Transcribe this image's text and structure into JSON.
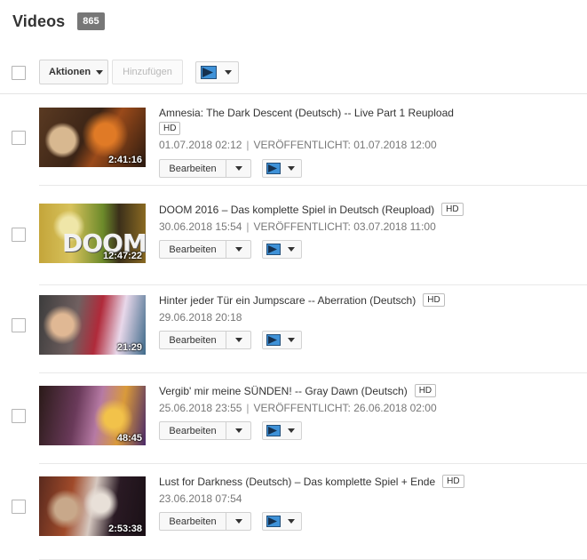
{
  "header": {
    "title": "Videos",
    "count": "865"
  },
  "toolbar": {
    "actions_label": "Aktionen",
    "add_label": "Hinzufügen"
  },
  "icons": {
    "dropdown": "chevron-down-icon",
    "playlist": "playlist-add-icon"
  },
  "colors": {
    "badge_bg": "#777777",
    "playlist_icon": "#3f92d8",
    "meta_text": "#777777"
  },
  "videos": [
    {
      "title": "Amnesia: The Dark Descent (Deutsch) -- Live Part 1 Reupload",
      "hd": "HD",
      "date": "01.07.2018 02:12",
      "published": "VERÖFFENTLICHT: 01.07.2018 12:00",
      "duration": "2:41:16",
      "edit_label": "Bearbeiten"
    },
    {
      "title": "DOOM 2016 – Das komplette Spiel in Deutsch (Reupload)",
      "hd": "HD",
      "date": "30.06.2018 15:54",
      "published": "VERÖFFENTLICHT: 03.07.2018 11:00",
      "duration": "12:47:22",
      "edit_label": "Bearbeiten",
      "thumb_text": "DOOM"
    },
    {
      "title": "Hinter jeder Tür ein Jumpscare -- Aberration (Deutsch)",
      "hd": "HD",
      "date": "29.06.2018 20:18",
      "duration": "21:29",
      "edit_label": "Bearbeiten"
    },
    {
      "title": "Vergib' mir meine SÜNDEN! -- Gray Dawn (Deutsch)",
      "hd": "HD",
      "date": "25.06.2018 23:55",
      "published": "VERÖFFENTLICHT: 26.06.2018 02:00",
      "duration": "48:45",
      "edit_label": "Bearbeiten"
    },
    {
      "title": "Lust for Darkness (Deutsch) – Das komplette Spiel + Ende",
      "hd": "HD",
      "date": "23.06.2018 07:54",
      "duration": "2:53:38",
      "edit_label": "Bearbeiten"
    }
  ]
}
